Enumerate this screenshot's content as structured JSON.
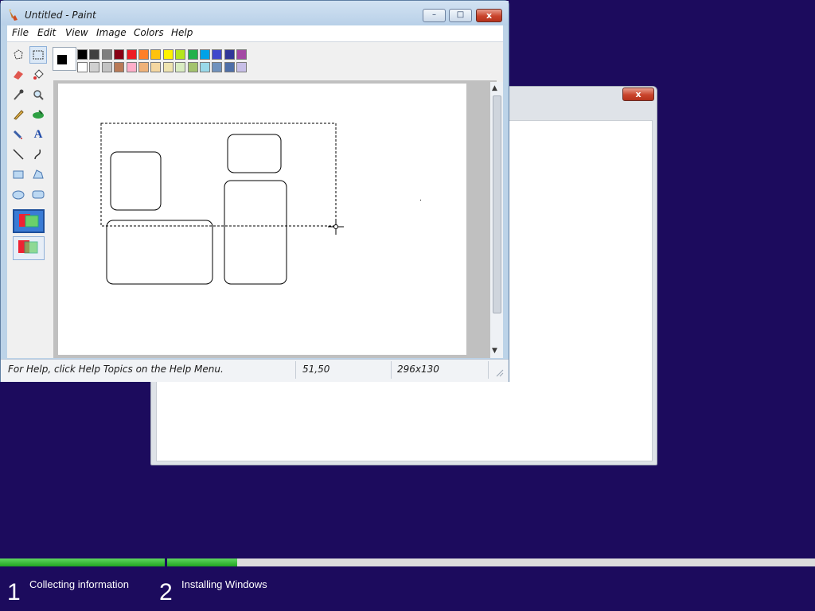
{
  "paint": {
    "title": "Untitled - Paint",
    "window_buttons": {
      "minimize": "–",
      "maximize": "□",
      "close": "x"
    },
    "menu": [
      "File",
      "Edit",
      "View",
      "Image",
      "Colors",
      "Help"
    ],
    "tools": [
      "free-form-select",
      "rectangle-select",
      "eraser",
      "fill-bucket",
      "color-picker",
      "magnifier",
      "pencil",
      "brush",
      "airbrush",
      "text",
      "line",
      "curve",
      "rectangle",
      "polygon",
      "ellipse",
      "rounded-rectangle"
    ],
    "palette": {
      "foreground": "#000000",
      "background": "#ffffff",
      "row1": [
        "#000000",
        "#404040",
        "#7f7f7f",
        "#880015",
        "#ed1c24",
        "#ff7f27",
        "#ffc20e",
        "#fff200",
        "#b5e61d",
        "#22b14c",
        "#00a2e8",
        "#3f48cc",
        "#2f3699",
        "#a349a4"
      ],
      "row2": [
        "#ffffff",
        "#d0d0d0",
        "#c3c3c3",
        "#b97a57",
        "#ffaec9",
        "#efb279",
        "#f5d7a1",
        "#efe4b0",
        "#d9ecc1",
        "#a3c36e",
        "#99d9ea",
        "#7092be",
        "#4f6fa8",
        "#c8bfe7"
      ]
    },
    "status": {
      "help": "For Help, click Help Topics on the Help Menu.",
      "position": "51,50",
      "selection": "296x130"
    }
  },
  "setup_window": {
    "close": "x"
  },
  "install": {
    "step1_number": "1",
    "step1_label": "Collecting information",
    "step2_number": "2",
    "step2_label": "Installing Windows",
    "step1_complete": 1.0,
    "step2_progress": 0.3
  }
}
